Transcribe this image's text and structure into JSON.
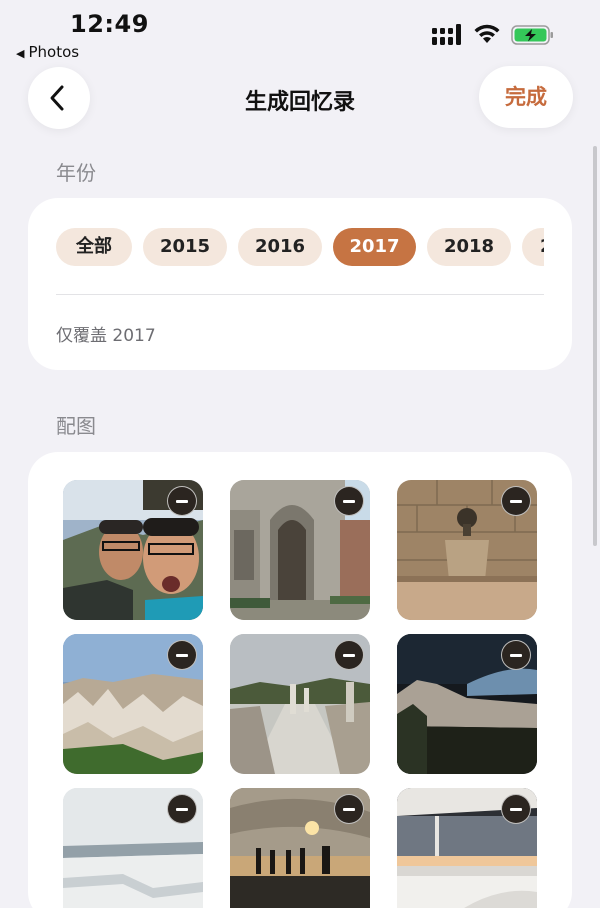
{
  "status": {
    "time": "12:49",
    "back_app": "Photos",
    "back_app_icon": "triangle-left-icon"
  },
  "nav": {
    "title": "生成回忆录",
    "done_label": "完成",
    "back_icon": "chevron-left-icon"
  },
  "year_section": {
    "label": "年份",
    "chips": [
      "全部",
      "2015",
      "2016",
      "2017",
      "2018",
      "2"
    ],
    "selected": "2017",
    "coverage_text": "仅覆盖 2017"
  },
  "photo_section": {
    "label": "配图",
    "photos": [
      {
        "name": "selfie-photo"
      },
      {
        "name": "ornate-gate-photo"
      },
      {
        "name": "stone-fountain-photo"
      },
      {
        "name": "rock-valley-photo"
      },
      {
        "name": "ruins-path-photo"
      },
      {
        "name": "night-cliff-photo"
      },
      {
        "name": "travertine-terrace-photo"
      },
      {
        "name": "sunset-pier-photo"
      },
      {
        "name": "boat-deck-photo"
      }
    ]
  },
  "colors": {
    "accent": "#c66b3d",
    "chip_bg": "#f4e7dd",
    "chip_active_bg": "#c67443",
    "page_bg": "#f2f1f6"
  }
}
